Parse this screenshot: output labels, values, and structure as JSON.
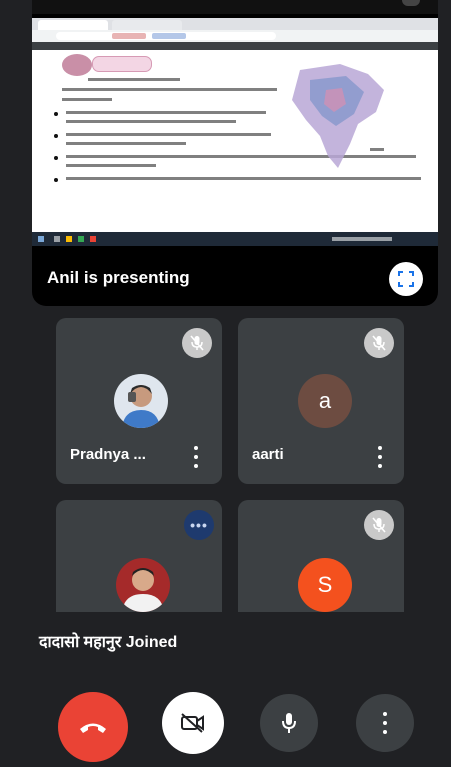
{
  "presentation": {
    "presenter_label": "Anil is presenting"
  },
  "participants": [
    {
      "name": "Pradnya ...",
      "avatar": "photo",
      "mic": "muted"
    },
    {
      "name": "aarti",
      "avatar": "a",
      "avatar_color": "#6d4c41",
      "mic": "muted"
    },
    {
      "name": "",
      "avatar": "photo",
      "mic": "speaking"
    },
    {
      "name": "",
      "avatar": "S",
      "avatar_color": "#f4511e",
      "mic": "muted"
    }
  ],
  "notification": {
    "text": "दादासो महानुर Joined"
  },
  "controls": {
    "end_call_icon": "phone-hangup-icon",
    "camera_icon": "camera-off-icon",
    "mic_icon": "mic-icon",
    "more_icon": "more-vert-icon"
  },
  "colors": {
    "background": "#202124",
    "tile": "#3c4043",
    "end_call": "#ea4335",
    "accent_s": "#f4511e"
  }
}
